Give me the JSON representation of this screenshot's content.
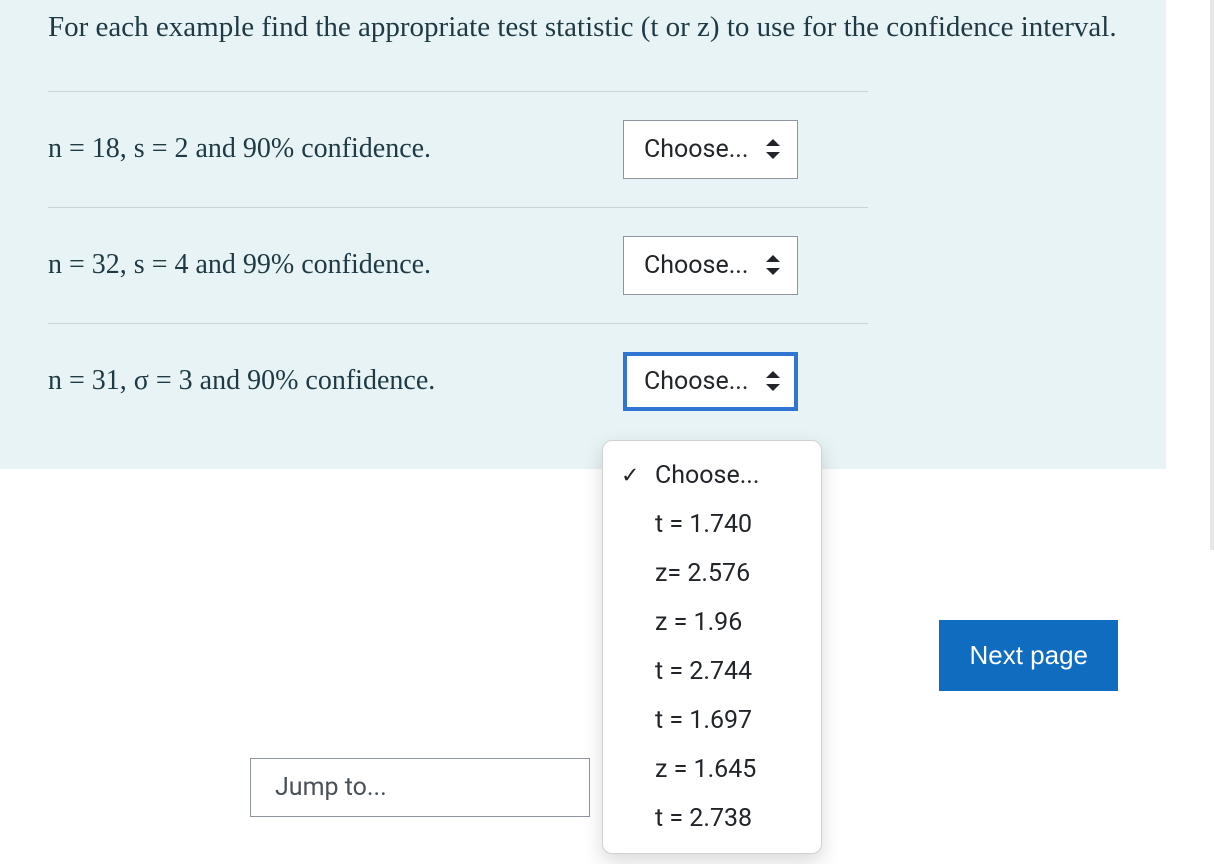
{
  "question": {
    "prompt": "For each example find the appropriate test statistic (t or z) to use for the confidence interval."
  },
  "rows": [
    {
      "prompt": "n = 18, s = 2 and 90% confidence.",
      "selected": "Choose..."
    },
    {
      "prompt": "n = 32, s = 4 and 99% confidence.",
      "selected": "Choose..."
    },
    {
      "prompt": "n = 31, σ = 3 and 90% confidence.",
      "selected": "Choose..."
    }
  ],
  "dropdown": {
    "options": [
      "Choose...",
      "t = 1.740",
      "z= 2.576",
      "z = 1.96",
      "t = 2.744",
      "t = 1.697",
      "z = 1.645",
      "t = 2.738"
    ],
    "checked_index": 0
  },
  "nav": {
    "next_label": "Next page",
    "jump_label": "Jump to..."
  }
}
